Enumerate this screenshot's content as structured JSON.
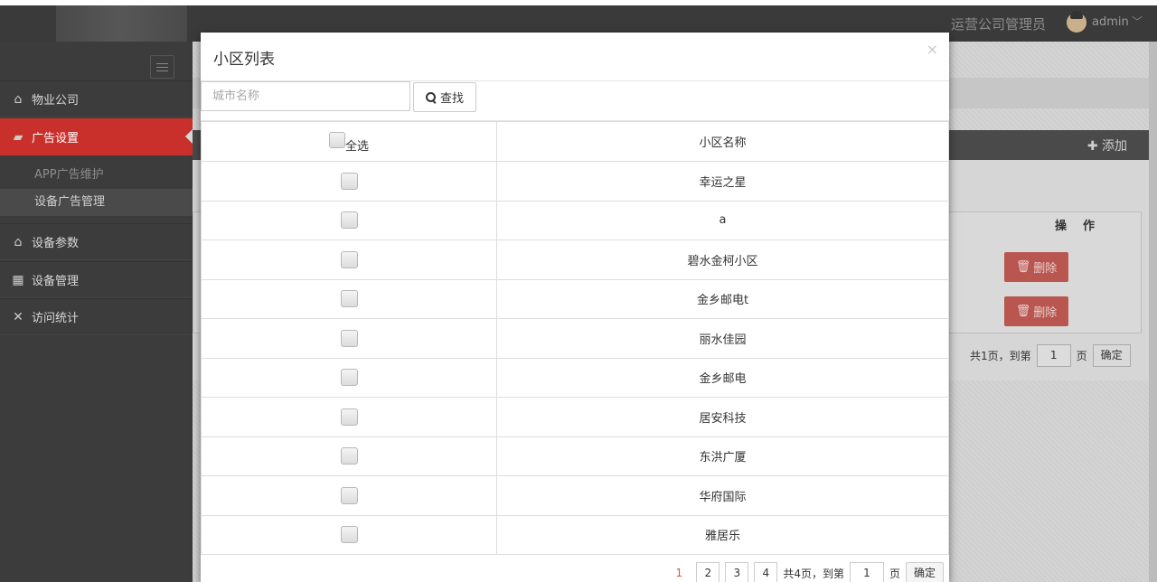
{
  "header": {
    "user_role": "运营公司管理员",
    "user_name": "admin",
    "user_icon": "avatar-icon",
    "caret_icon": "chevron-down-icon"
  },
  "sidebar": {
    "items": [
      {
        "label": "物业公司",
        "icon": "home-icon"
      },
      {
        "label": "广告设置",
        "icon": "ad-icon"
      },
      {
        "label": "设备参数",
        "icon": "home-icon"
      },
      {
        "label": "设备管理",
        "icon": "device-grid-icon"
      },
      {
        "label": "访问统计",
        "icon": "close-x-icon"
      }
    ],
    "sub_items": [
      {
        "label": "APP广告维护"
      },
      {
        "label": "设备广告管理"
      }
    ]
  },
  "background": {
    "add_label": "添加",
    "op_header": "操作",
    "delete_label": "删除",
    "pager": {
      "total": "共1页，到第",
      "page_value": "1",
      "unit": "页",
      "confirm": "确定"
    }
  },
  "modal": {
    "title": "小区列表",
    "close": "×",
    "search": {
      "placeholder": "城市名称",
      "button_label": "查找"
    },
    "table": {
      "select_all_label": "全选",
      "name_header": "小区名称",
      "rows": [
        "幸运之星",
        "a",
        "碧水金柯小区",
        "金乡邮电t",
        "丽水佳园",
        "金乡邮电",
        "居安科技",
        "东洪广厦",
        "华府国际",
        "雅居乐"
      ]
    },
    "pager": {
      "pages": [
        "1",
        "2",
        "3",
        "4"
      ],
      "current_page": "1",
      "total": "共4页，到第",
      "page_value": "1",
      "unit": "页",
      "confirm": "确定"
    }
  },
  "colors": {
    "accent_red": "#c9302c",
    "header_dark": "#3a3a3a",
    "sidebar_dark": "#3c3c3c"
  }
}
